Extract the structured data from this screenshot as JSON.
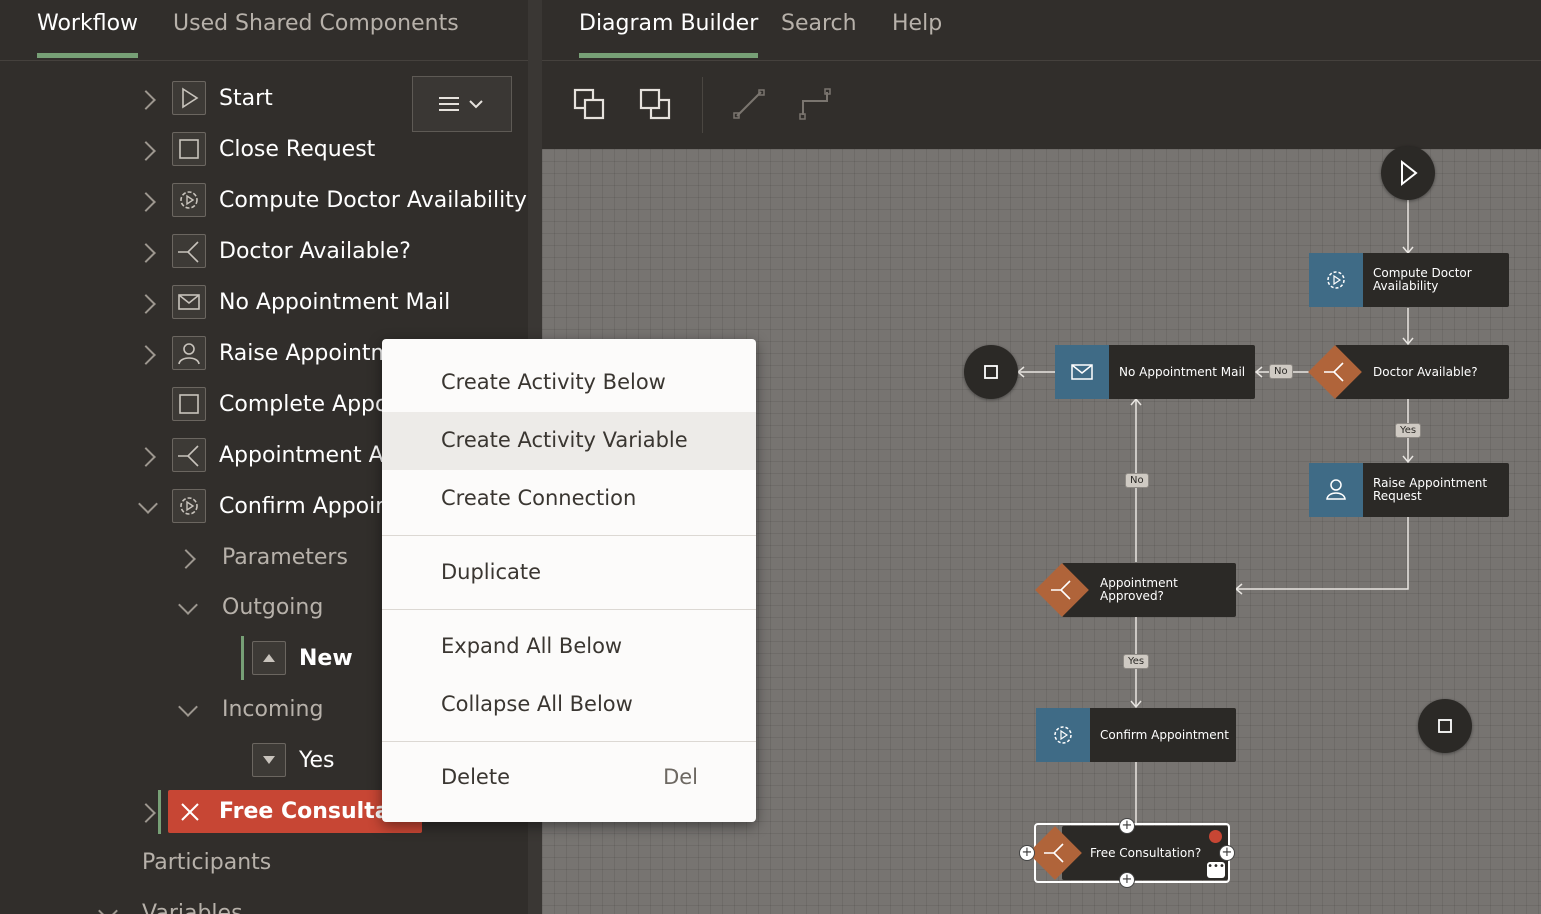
{
  "left_panel": {
    "tabs": [
      {
        "label": "Workflow",
        "active": true
      },
      {
        "label": "Used Shared Components",
        "active": false
      }
    ],
    "tree": [
      {
        "label": "Start",
        "icon": "play-icon",
        "expanded": false
      },
      {
        "label": "Close Request",
        "icon": "square-icon",
        "expanded": false
      },
      {
        "label": "Compute Doctor Availability",
        "icon": "gear-icon",
        "expanded": false
      },
      {
        "label": "Doctor Available?",
        "icon": "branch-icon",
        "expanded": false
      },
      {
        "label": "No Appointment Mail",
        "icon": "mail-icon",
        "expanded": false
      },
      {
        "label": "Raise Appointme",
        "icon": "user-icon",
        "expanded": false
      },
      {
        "label": "Complete Appoi",
        "icon": "square-icon",
        "expanded": false
      },
      {
        "label": "Appointment Ap",
        "icon": "branch-icon",
        "expanded": false
      },
      {
        "label": "Confirm Appoint",
        "icon": "gear-icon",
        "expanded": true
      }
    ],
    "sub_tree": {
      "parameters": "Parameters",
      "outgoing": "Outgoing",
      "outgoing_item": "New",
      "incoming": "Incoming",
      "incoming_item": "Yes"
    },
    "selected_item": "Free Consultatio",
    "participants": "Participants",
    "variables": "Variables"
  },
  "context_menu": {
    "items": [
      {
        "label": "Create Activity Below",
        "shortcut": ""
      },
      {
        "label": "Create Activity Variable",
        "shortcut": "",
        "highlighted": true
      },
      {
        "label": "Create Connection",
        "shortcut": ""
      },
      {
        "label": "Duplicate",
        "shortcut": ""
      },
      {
        "label": "Expand All Below",
        "shortcut": ""
      },
      {
        "label": "Collapse All Below",
        "shortcut": ""
      },
      {
        "label": "Delete",
        "shortcut": "Del"
      }
    ]
  },
  "right_panel": {
    "tabs": [
      {
        "label": "Diagram Builder",
        "active": true
      },
      {
        "label": "Search",
        "active": false
      },
      {
        "label": "Help",
        "active": false
      }
    ]
  },
  "diagram": {
    "nodes": {
      "compute": "Compute Doctor Availability",
      "doctor_available": "Doctor Available?",
      "no_mail": "No Appointment Mail",
      "raise": "Raise Appointment Request",
      "appt_approved": "Appointment Approved?",
      "confirm": "Confirm Appointment",
      "free": "Free Consultation?"
    },
    "edge_labels": {
      "no1": "No",
      "yes1": "Yes",
      "no2": "No",
      "yes2": "Yes"
    }
  },
  "colors": {
    "accent": "#77a076",
    "error": "#c74634",
    "service": "#3f6b86",
    "gateway": "#b0643a"
  }
}
